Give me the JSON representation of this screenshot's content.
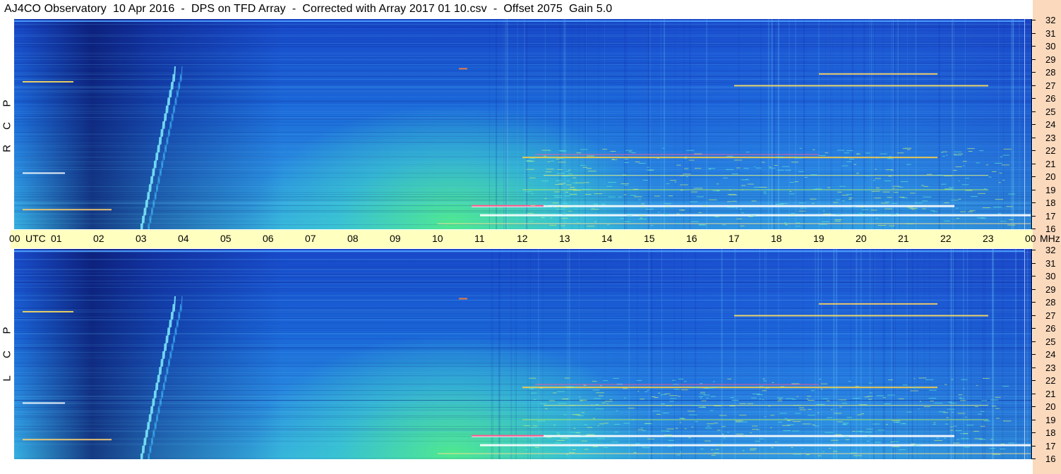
{
  "title": "AJ4CO Observatory  10 Apr 2016  -  DPS on TFD Array  -  Corrected with Array 2017 01 10.csv  -  Offset 2075  Gain 5.0",
  "time_axis": {
    "labels": [
      "00",
      "01",
      "02",
      "03",
      "04",
      "05",
      "06",
      "07",
      "08",
      "09",
      "10",
      "11",
      "12",
      "13",
      "14",
      "15",
      "16",
      "17",
      "18",
      "19",
      "20",
      "21",
      "22",
      "23",
      "00"
    ],
    "unit_left": "UTC",
    "unit_right": "MHz"
  },
  "panels": [
    {
      "label": "R C P",
      "letters": [
        "R",
        "C",
        "P"
      ]
    },
    {
      "label": "L C P",
      "letters": [
        "L",
        "C",
        "P"
      ]
    }
  ],
  "colors": {
    "background_deep": "#1850d0",
    "background_dark": "#1020a0",
    "daytime_green": "#40e890",
    "cyan": "#30c0f0",
    "time_band": "#ffffc0",
    "freq_band": "#fbd9bd"
  },
  "chart_data": {
    "type": "heatmap",
    "title": "AJ4CO Observatory  10 Apr 2016  -  DPS on TFD Array  -  Corrected with Array 2017 01 10.csv  -  Offset 2075  Gain 5.0",
    "xlabel": "UTC",
    "ylabel": "MHz",
    "x_range_hours": [
      0,
      24
    ],
    "y_range_mhz": [
      16,
      32
    ],
    "x_ticks": [
      "00",
      "01",
      "02",
      "03",
      "04",
      "05",
      "06",
      "07",
      "08",
      "09",
      "10",
      "11",
      "12",
      "13",
      "14",
      "15",
      "16",
      "17",
      "18",
      "19",
      "20",
      "21",
      "22",
      "23",
      "00"
    ],
    "y_ticks": [
      16,
      17,
      18,
      19,
      20,
      21,
      22,
      23,
      24,
      25,
      26,
      27,
      28,
      29,
      30,
      31,
      32
    ],
    "panels": [
      "R C P",
      "L C P"
    ],
    "features": {
      "burst_hours": [
        3.0,
        3.8
      ],
      "interference_freqs_mhz": [
        17.0,
        17.8,
        21.5,
        27.0
      ]
    }
  }
}
